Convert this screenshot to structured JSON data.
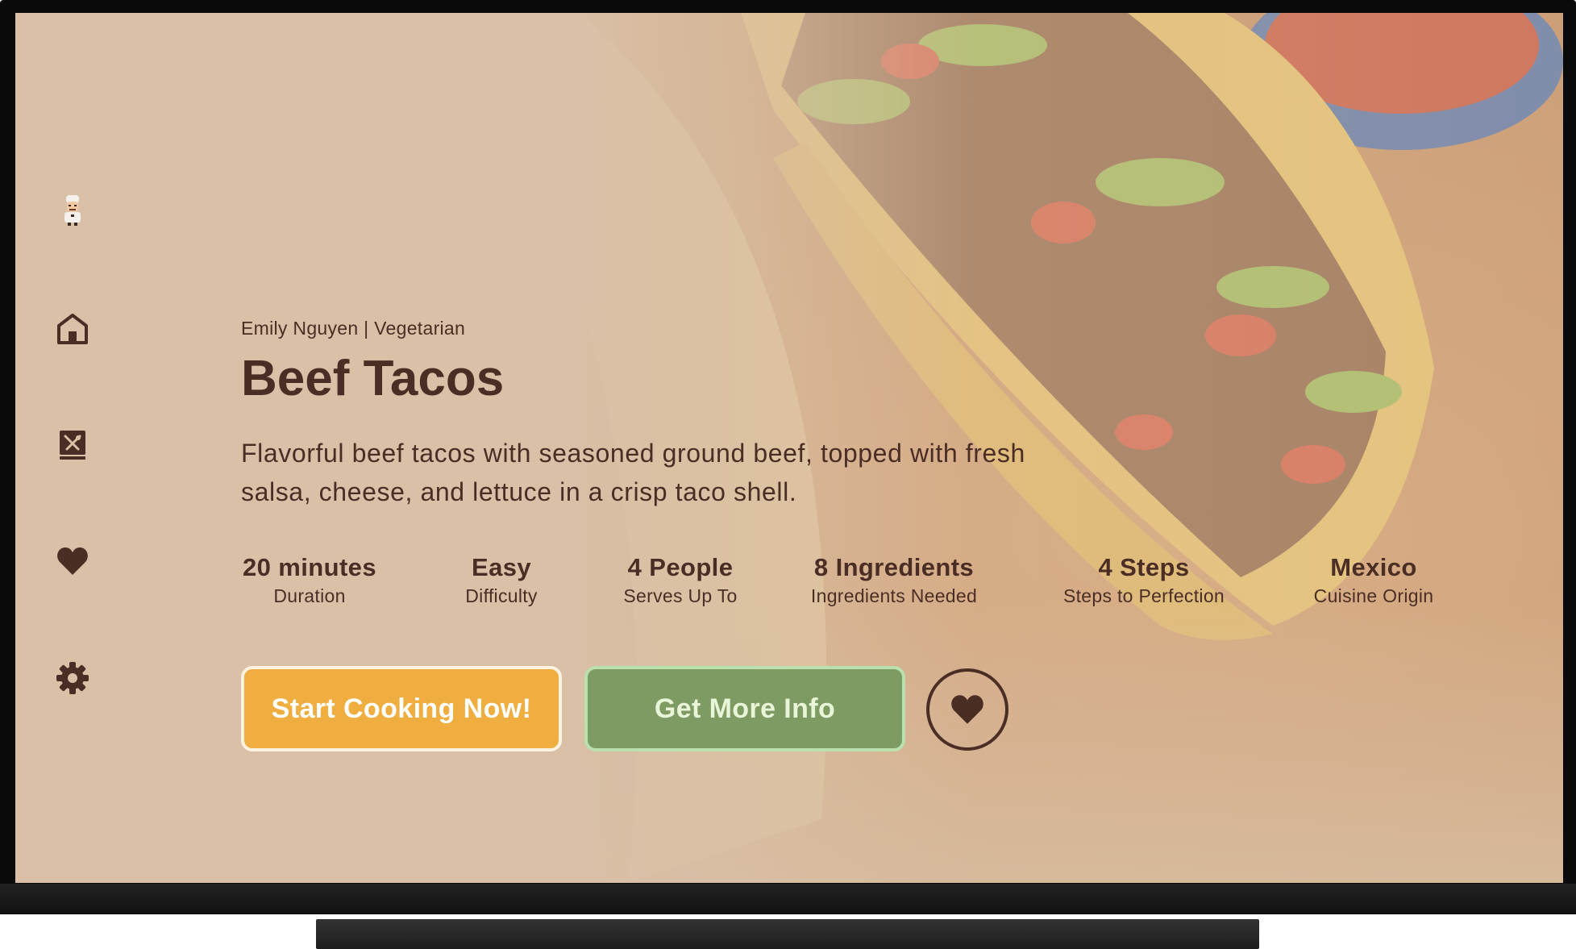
{
  "recipe": {
    "byline": "Emily Nguyen | Vegetarian",
    "title": "Beef Tacos",
    "description": "Flavorful beef tacos with seasoned ground beef, topped with fresh salsa, cheese, and lettuce in a crisp taco shell."
  },
  "stats": [
    {
      "value": "20 minutes",
      "label": "Duration"
    },
    {
      "value": "Easy",
      "label": "Difficulty"
    },
    {
      "value": "4 People",
      "label": "Serves Up To"
    },
    {
      "value": "8 Ingredients",
      "label": "Ingredients Needed"
    },
    {
      "value": "4 Steps",
      "label": "Steps to Perfection"
    },
    {
      "value": "Mexico",
      "label": "Cuisine Origin"
    }
  ],
  "actions": {
    "start_label": "Start Cooking Now!",
    "info_label": "Get More Info"
  },
  "sidebar": {
    "items": [
      {
        "icon": "chef-avatar-icon"
      },
      {
        "icon": "home-icon"
      },
      {
        "icon": "recipe-book-icon"
      },
      {
        "icon": "heart-icon"
      },
      {
        "icon": "gear-icon"
      }
    ]
  },
  "colors": {
    "background": "#d9c0a6",
    "text": "#4a2e26",
    "primary_button": "#efae3f",
    "secondary_button": "#7f9b64",
    "secondary_button_text": "#e8f5d8"
  }
}
